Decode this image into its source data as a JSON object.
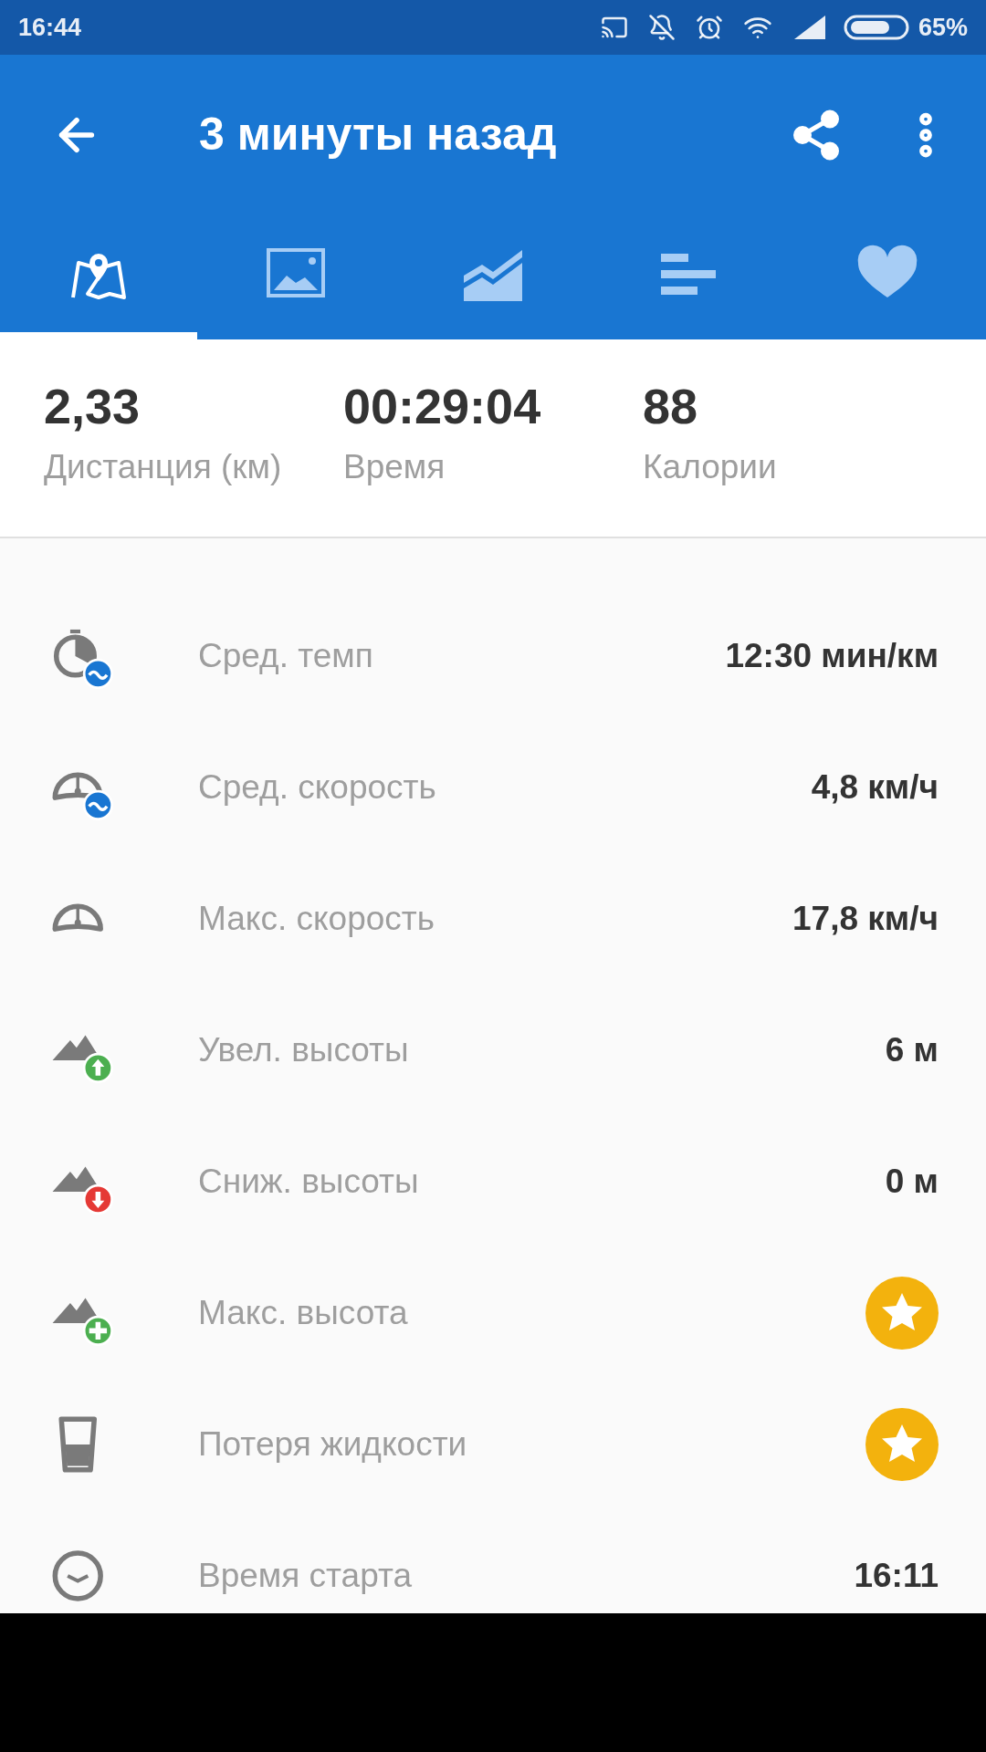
{
  "status_bar": {
    "time": "16:44",
    "battery": "65%"
  },
  "app_bar": {
    "title": "3 минуты назад"
  },
  "tabs": [
    {
      "selected": true
    },
    {
      "selected": false
    },
    {
      "selected": false
    },
    {
      "selected": false
    },
    {
      "selected": false
    }
  ],
  "summary": [
    {
      "value": "2,33",
      "label": "Дистанция (км)"
    },
    {
      "value": "00:29:04",
      "label": "Время"
    },
    {
      "value": "88",
      "label": "Калории"
    }
  ],
  "stats": [
    {
      "kind": "text",
      "label": "Сред. темп",
      "value": "12:30 мин/км"
    },
    {
      "kind": "text",
      "label": "Сред. скорость",
      "value": "4,8 км/ч"
    },
    {
      "kind": "text",
      "label": "Макс. скорость",
      "value": "17,8 км/ч"
    },
    {
      "kind": "text",
      "label": "Увел. высоты",
      "value": "6 м"
    },
    {
      "kind": "text",
      "label": "Сниж. высоты",
      "value": "0 м"
    },
    {
      "kind": "star",
      "label": "Макс. высота"
    },
    {
      "kind": "star",
      "label": "Потеря жидкости"
    },
    {
      "kind": "text",
      "label": "Время старта",
      "value": "16:11"
    }
  ]
}
